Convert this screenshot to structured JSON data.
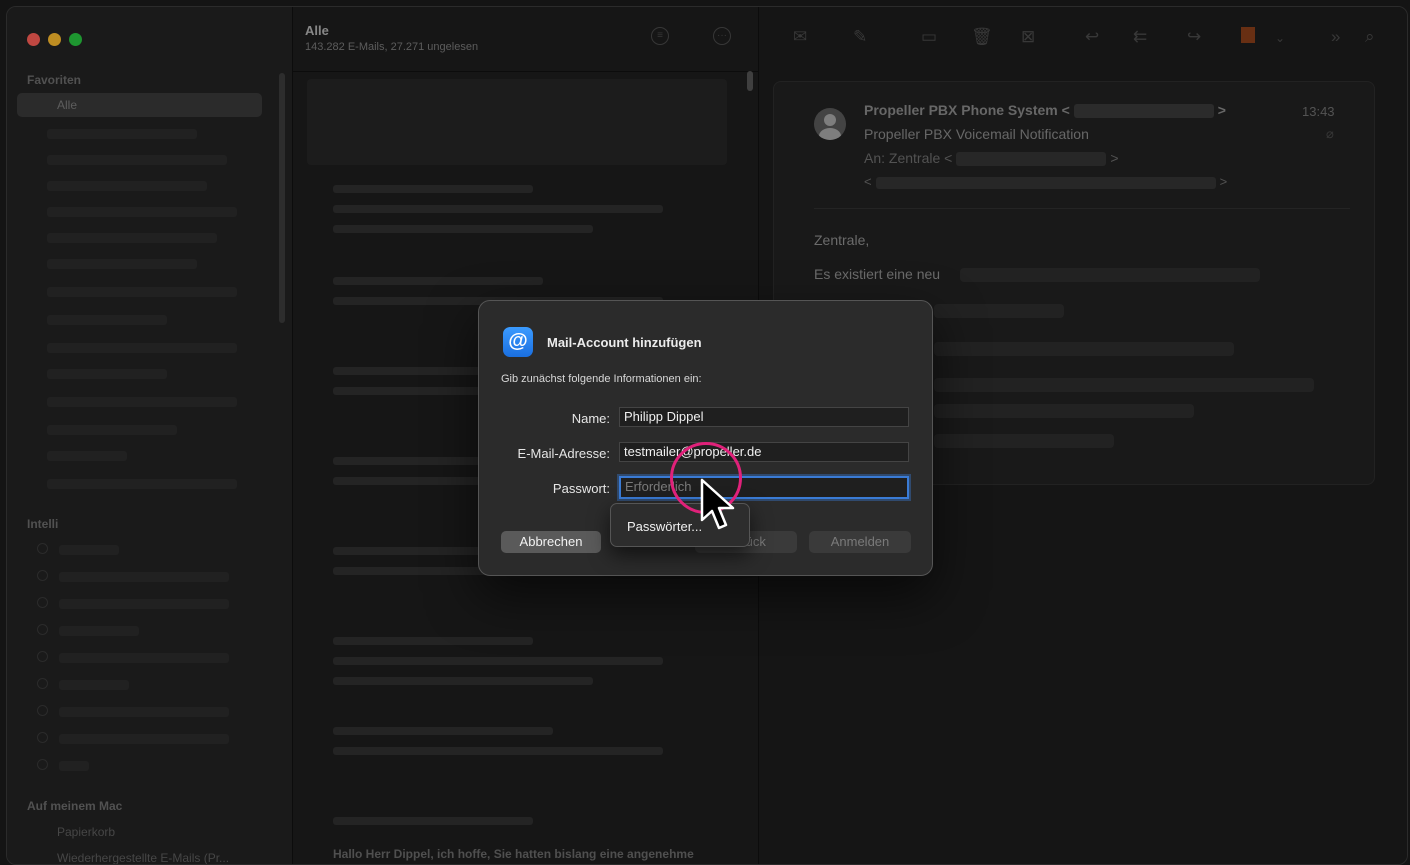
{
  "sidebar": {
    "favorites_header": "Favoriten",
    "selected_item": "Alle",
    "intelligent_header": "Intelli",
    "local_header": "Auf meinem Mac",
    "trash": "Papierkorb",
    "restored": "Wiederhergestellte E-Mails (Pr..."
  },
  "list": {
    "title": "Alle",
    "subtitle": "143.282 E-Mails, 27.271 ungelesen",
    "bottom_snippet": "Hallo Herr Dippel, ich hoffe, Sie hatten bislang eine angenehme"
  },
  "reader": {
    "sender": "Propeller PBX Phone System <",
    "sender_end": ">",
    "subject": "Propeller PBX Voicemail Notification",
    "to_label": "An:",
    "to_name": "Zentrale <",
    "to_end": ">",
    "to2_start": "<",
    "to2_end": ">",
    "time": "13:43",
    "greeting": "Zentrale,",
    "body_start": "Es existiert eine neu"
  },
  "dialog": {
    "title": "Mail-Account hinzufügen",
    "subtitle": "Gib zunächst folgende Informationen ein:",
    "name_label": "Name:",
    "name_value": "Philipp Dippel",
    "email_label": "E-Mail-Adresse:",
    "email_value": "testmailer@propeller.de",
    "password_label": "Passwort:",
    "password_placeholder": "Erforderlich",
    "cancel": "Abbrechen",
    "back": "Zurück",
    "login": "Anmelden",
    "popup_item": "Passwörter..."
  },
  "colors": {
    "accent": "#3a7bd5",
    "highlight_ring": "#e0217a"
  }
}
